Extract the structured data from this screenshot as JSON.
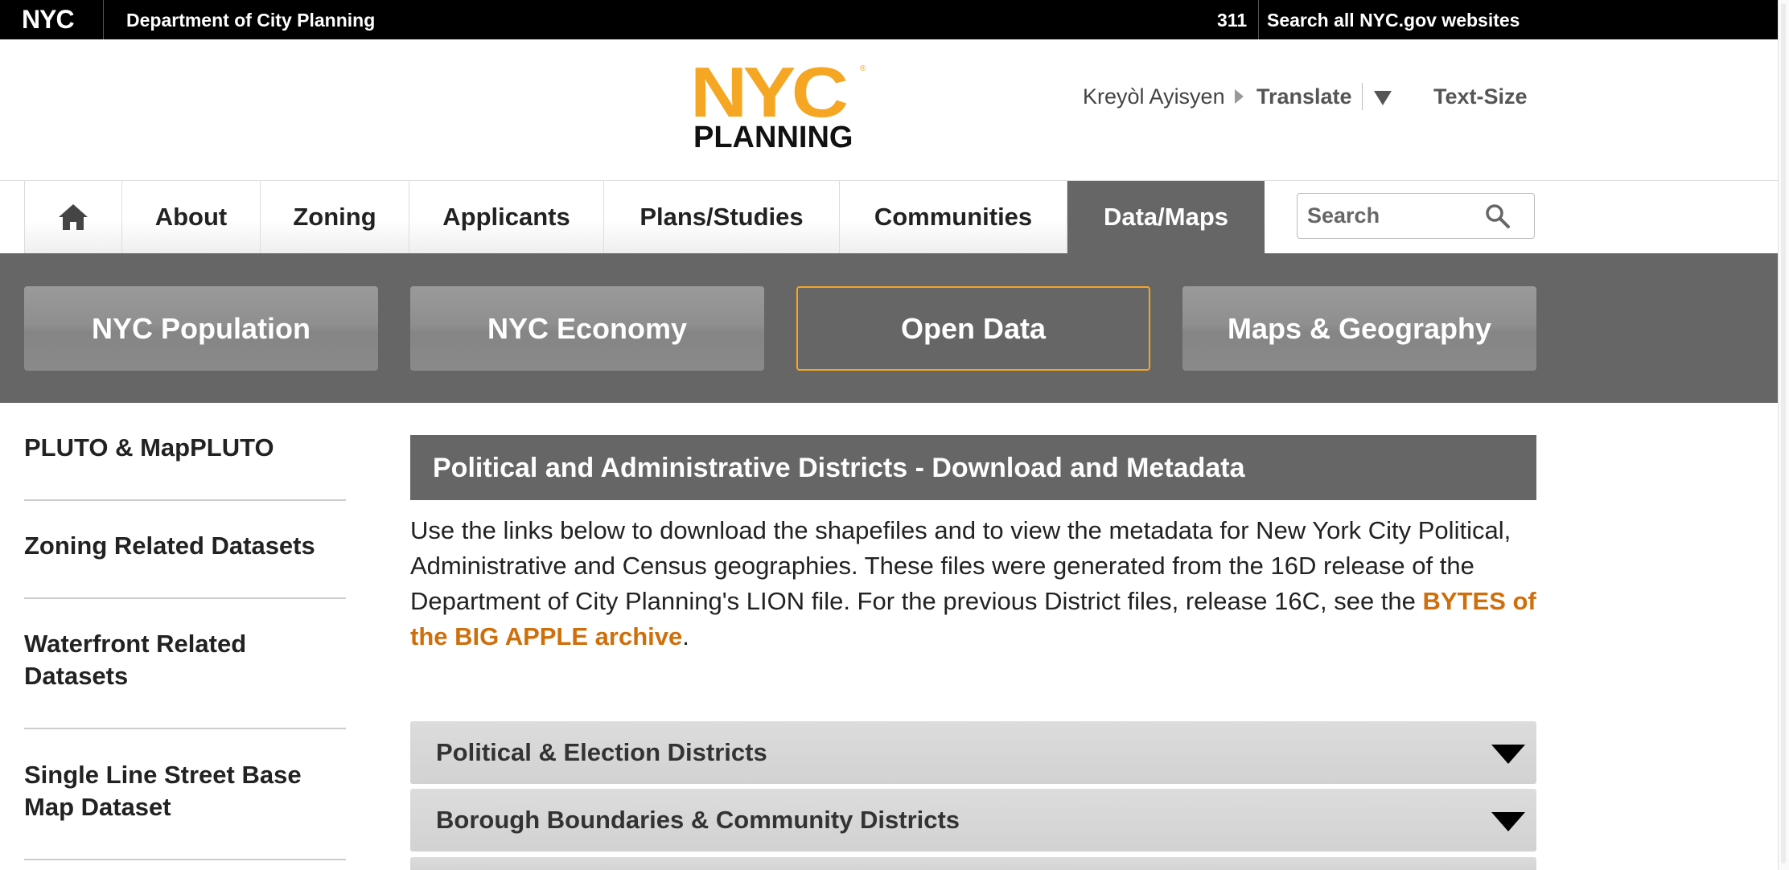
{
  "topbar": {
    "logo_text": "NYC",
    "department": "Department of City Planning",
    "link_311": "311",
    "search_all": "Search all NYC.gov websites"
  },
  "header": {
    "logo_nyc": "NYC",
    "logo_registered": "®",
    "logo_planning": "PLANNING",
    "language": "Kreyòl Ayisyen",
    "translate": "Translate",
    "text_size": "Text-Size",
    "brand_color": "#f5a623"
  },
  "mainnav": {
    "home_icon": "home-icon",
    "items": [
      {
        "label": "About"
      },
      {
        "label": "Zoning"
      },
      {
        "label": "Applicants"
      },
      {
        "label": "Plans/Studies"
      },
      {
        "label": "Communities"
      },
      {
        "label": "Data/Maps",
        "active": true
      }
    ],
    "search_placeholder": "Search",
    "search_icon": "search-icon"
  },
  "subnav": {
    "items": [
      {
        "label": "NYC Population"
      },
      {
        "label": "NYC Economy"
      },
      {
        "label": "Open Data",
        "active": true
      },
      {
        "label": "Maps & Geography"
      }
    ]
  },
  "sidebar": {
    "items": [
      {
        "line1": "PLUTO & MapPLUTO",
        "line2": ""
      },
      {
        "line1": "Zoning Related Datasets",
        "line2": ""
      },
      {
        "line1": "Waterfront Related",
        "line2": "Datasets"
      },
      {
        "line1": "Single Line Street Base",
        "line2": "Map Dataset"
      }
    ]
  },
  "content": {
    "title": "Political and Administrative Districts - Download and Metadata",
    "intro_text": "Use the links below to download the shapefiles and to view the metadata for New York City Political, Administrative and Census geographies. These files were generated from the 16D release of the Department of City Planning's LION file. For the previous District files, release 16C, see the ",
    "intro_link": "BYTES of the BIG APPLE archive",
    "intro_end": ".",
    "link_color": "#cf6f0c",
    "accordions": [
      {
        "label": "Political & Election Districts"
      },
      {
        "label": "Borough Boundaries & Community Districts"
      }
    ]
  }
}
